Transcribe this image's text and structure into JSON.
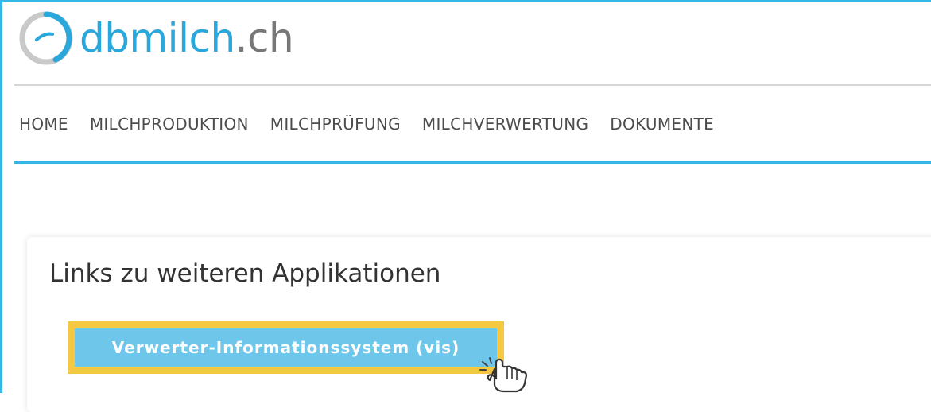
{
  "header": {
    "logo_brand": "dbmilch",
    "logo_tld": ".ch",
    "logo_icon": "dbmilch-logo-icon",
    "brand_color": "#2aa7db"
  },
  "nav": {
    "items": [
      {
        "label": "HOME"
      },
      {
        "label": "MILCHPRODUKTION"
      },
      {
        "label": "MILCHPRÜFUNG"
      },
      {
        "label": "MILCHVERWERTUNG"
      },
      {
        "label": "DOKUMENTE"
      }
    ],
    "accent_color": "#35b6e8"
  },
  "card": {
    "title": "Links zu weiteren Applikationen",
    "button_label": "Verwerter-Informationssystem (vis)",
    "button_color": "#6ec7ea",
    "highlight_color": "#f5c842",
    "cursor_icon": "hand-pointer-click-icon"
  }
}
